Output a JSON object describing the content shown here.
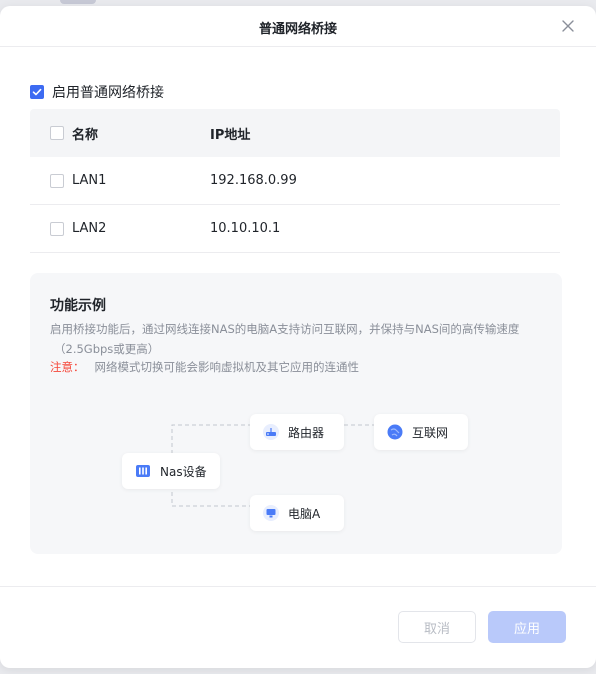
{
  "dialog": {
    "title": "普通网络桥接",
    "close_icon": "close-icon"
  },
  "enable_bridge": {
    "label": "启用普通网络桥接",
    "checked": true
  },
  "table": {
    "headers": {
      "name": "名称",
      "ip": "IP地址"
    },
    "rows": [
      {
        "name": "LAN1",
        "ip": "192.168.0.99",
        "checked": false
      },
      {
        "name": "LAN2",
        "ip": "10.10.10.1",
        "checked": false
      }
    ]
  },
  "example": {
    "title": "功能示例",
    "description_line1": "启用桥接功能后，通过网线连接NAS的电脑A支持访问互联网，并保持与NAS间的高传输速度",
    "description_line2": "（2.5Gbps或更高）",
    "note_label": "注意：",
    "note_text": "网络模式切换可能会影响虚拟机及其它应用的连通性",
    "nodes": {
      "nas": "Nas设备",
      "router": "路由器",
      "internet": "互联网",
      "pc": "电脑A"
    }
  },
  "footer": {
    "cancel_label": "取消",
    "apply_label": "应用"
  },
  "colors": {
    "accent": "#3d6bf2",
    "apply_disabled": "#b9c9fa",
    "warning": "#f5483b"
  }
}
